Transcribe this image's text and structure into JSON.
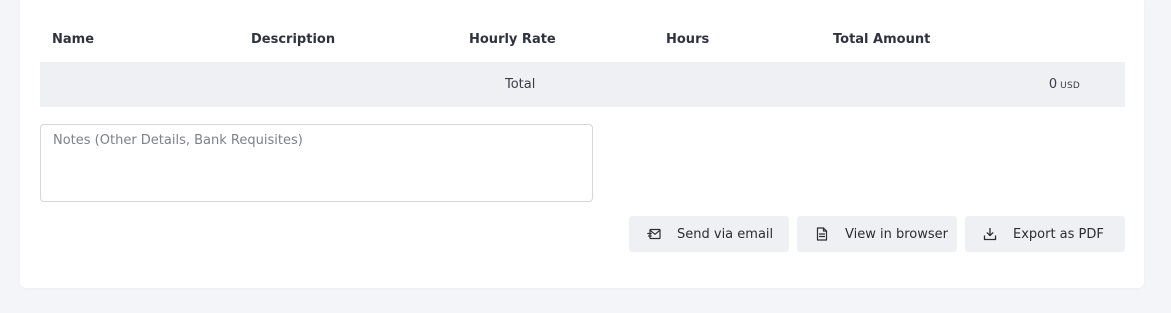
{
  "table": {
    "columns": [
      "Name",
      "Description",
      "Hourly Rate",
      "Hours",
      "Total Amount"
    ],
    "total_label": "Total",
    "total_value": "0",
    "total_currency": "USD"
  },
  "notes": {
    "placeholder": "Notes (Other Details, Bank Requisites)",
    "value": ""
  },
  "actions": {
    "send_email": "Send via email",
    "view_browser": "View in browser",
    "export_pdf": "Export as PDF"
  },
  "icons": {
    "send_email": "mail-send-icon",
    "view_browser": "document-icon",
    "export_pdf": "download-icon"
  },
  "colors": {
    "page_bg": "#f4f5f8",
    "card_bg": "#ffffff",
    "row_bg": "#eef0f4",
    "button_bg": "#eef0f4"
  }
}
